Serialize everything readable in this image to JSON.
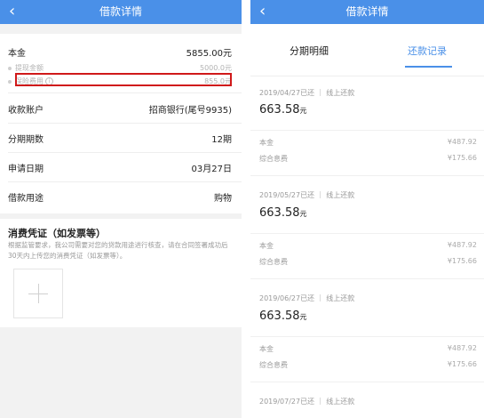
{
  "left": {
    "nav": {
      "back_icon": "chevron-left-icon",
      "title": "借款详情"
    },
    "principal": {
      "label": "本金",
      "value": "5855.00元"
    },
    "withdraw": {
      "label": "提现金额",
      "value": "5000.0元"
    },
    "insurance": {
      "label": "保险费用",
      "value": "855.0元",
      "info_icon": "i"
    },
    "rows": [
      {
        "label": "收款账户",
        "value": "招商银行(尾号9935)"
      },
      {
        "label": "分期期数",
        "value": "12期"
      },
      {
        "label": "申请日期",
        "value": "03月27日"
      },
      {
        "label": "借款用途",
        "value": "购物"
      }
    ],
    "voucher": {
      "title": "消费凭证（如发票等）",
      "desc": "根据监管要求，我公司需要对您的贷款用途进行核查，请在合同签署成功后30天内上传您的消费凭证（如发票等）。",
      "upload_icon": "plus-icon"
    }
  },
  "right": {
    "nav": {
      "back_icon": "chevron-left-icon",
      "title": "借款详情"
    },
    "tabs": [
      {
        "label": "分期明细"
      },
      {
        "label": "还款记录"
      }
    ],
    "active_tab": 1,
    "records": [
      {
        "head": "2019/04/27已还 ｜ 线上还款",
        "amount": "663.58",
        "unit": "元",
        "principal_label": "本金",
        "principal": "¥487.92",
        "interest_label": "综合息费",
        "interest": "¥175.66"
      },
      {
        "head": "2019/05/27已还 ｜ 线上还款",
        "amount": "663.58",
        "unit": "元",
        "principal_label": "本金",
        "principal": "¥487.92",
        "interest_label": "综合息费",
        "interest": "¥175.66"
      },
      {
        "head": "2019/06/27已还 ｜ 线上还款",
        "amount": "663.58",
        "unit": "元",
        "principal_label": "本金",
        "principal": "¥487.92",
        "interest_label": "综合息费",
        "interest": "¥175.66"
      },
      {
        "head": "2019/07/27已还 ｜ 线上还款"
      }
    ]
  },
  "colors": {
    "accent": "#4a90e8",
    "highlight": "#d0191a"
  }
}
